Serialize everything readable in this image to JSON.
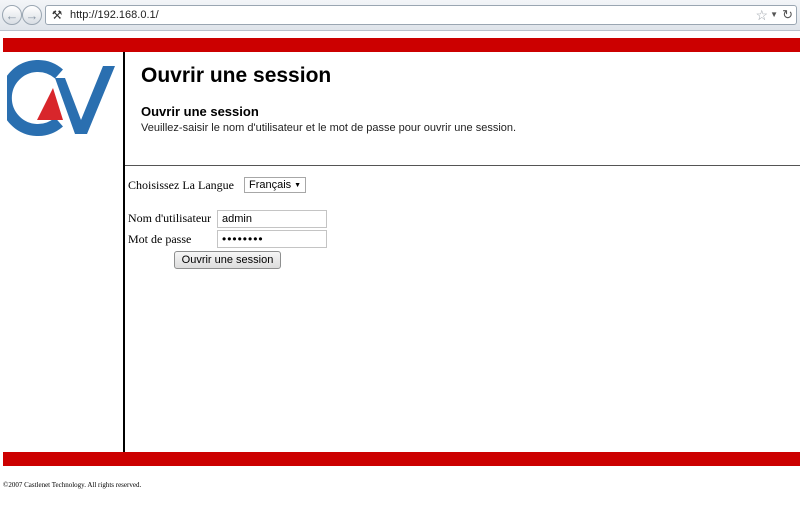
{
  "browser": {
    "url": "http://192.168.0.1/",
    "back_glyph": "←",
    "forward_glyph": "→",
    "site_icon_glyph": "⚒",
    "star_glyph": "☆",
    "dropdown_glyph": "▼",
    "reload_glyph": "↻"
  },
  "colors": {
    "brand_red": "#cc0000",
    "logo_blue": "#2a6fb0",
    "logo_red": "#d8262b"
  },
  "header": {
    "title": "Ouvrir une session",
    "subtitle": "Ouvrir une session",
    "instructions": "Veuillez-saisir le nom d'utilisateur et le mot de passe pour ouvrir une session."
  },
  "language": {
    "label": "Choisissez La Langue",
    "selected": "Français",
    "caret": "▼"
  },
  "form": {
    "username_label": "Nom d'utilisateur",
    "username_value": "admin",
    "password_label": "Mot de passe",
    "password_value": "••••••••",
    "submit_label": "Ouvrir une session"
  },
  "footer": {
    "copyright": "©2007 Castlenet Technology. All rights reserved."
  }
}
